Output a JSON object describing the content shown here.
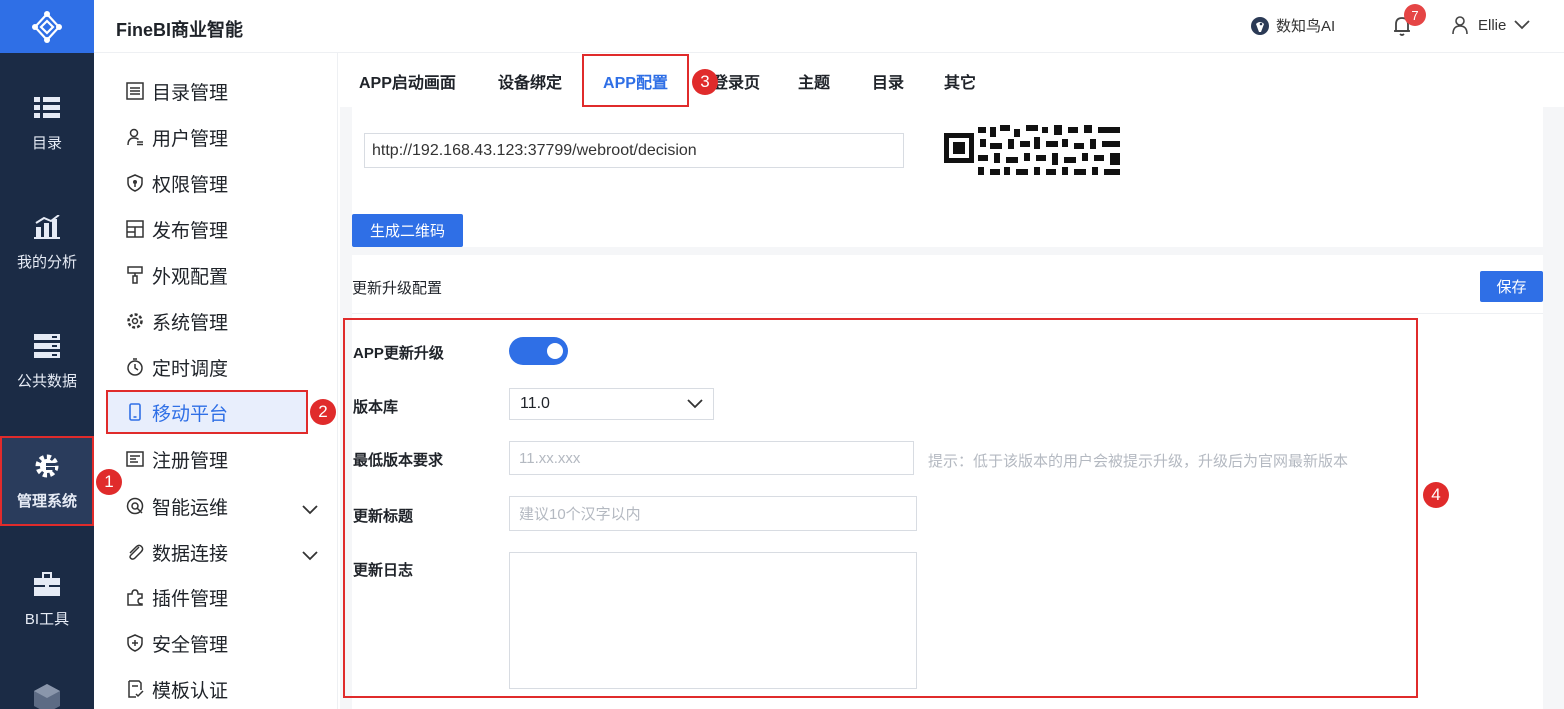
{
  "app": {
    "title": "FineBI商业智能",
    "logo_icon": "finebi-logo-icon"
  },
  "header": {
    "ai_label": "数知鸟AI",
    "notification_count": "7",
    "user_name": "Ellie"
  },
  "rail": {
    "items": [
      {
        "label": "目录",
        "icon": "catalog-icon"
      },
      {
        "label": "我的分析",
        "icon": "analysis-icon"
      },
      {
        "label": "公共数据",
        "icon": "database-icon"
      },
      {
        "label": "管理系统",
        "icon": "settings-icon",
        "active": true
      },
      {
        "label": "BI工具",
        "icon": "toolbox-icon"
      }
    ]
  },
  "menu": {
    "items": [
      {
        "label": "目录管理",
        "icon": "list-icon"
      },
      {
        "label": "用户管理",
        "icon": "user-icon"
      },
      {
        "label": "权限管理",
        "icon": "shield-icon"
      },
      {
        "label": "发布管理",
        "icon": "publish-icon"
      },
      {
        "label": "外观配置",
        "icon": "brush-icon"
      },
      {
        "label": "系统管理",
        "icon": "gear-icon"
      },
      {
        "label": "定时调度",
        "icon": "timer-icon"
      },
      {
        "label": "移动平台",
        "icon": "mobile-icon",
        "active": true
      },
      {
        "label": "注册管理",
        "icon": "register-icon"
      },
      {
        "label": "智能运维",
        "icon": "maintenance-icon",
        "expandable": true
      },
      {
        "label": "数据连接",
        "icon": "link-icon",
        "expandable": true
      },
      {
        "label": "插件管理",
        "icon": "plugin-icon"
      },
      {
        "label": "安全管理",
        "icon": "security-icon"
      },
      {
        "label": "模板认证",
        "icon": "template-icon"
      }
    ]
  },
  "tabs": [
    {
      "label": "APP启动画面"
    },
    {
      "label": "设备绑定"
    },
    {
      "label": "APP配置",
      "active": true
    },
    {
      "label": "登录页"
    },
    {
      "label": "主题"
    },
    {
      "label": "目录"
    },
    {
      "label": "其它"
    }
  ],
  "qr_section": {
    "url": "http://192.168.43.123:37799/webroot/decision",
    "generate_label": "生成二维码"
  },
  "update_section": {
    "title": "更新升级配置",
    "save_label": "保存",
    "app_update": {
      "label": "APP更新升级",
      "enabled": true
    },
    "version_repo": {
      "label": "版本库",
      "value": "11.0"
    },
    "min_version": {
      "label": "最低版本要求",
      "placeholder": "11.xx.xxx",
      "hint": "提示：低于该版本的用户会被提示升级，升级后为官网最新版本"
    },
    "update_title": {
      "label": "更新标题",
      "placeholder": "建议10个汉字以内"
    },
    "update_log": {
      "label": "更新日志",
      "value": ""
    }
  },
  "markers": [
    "1",
    "2",
    "3",
    "4"
  ],
  "colors": {
    "accent": "#2f6fe6",
    "rail_bg": "#1b2b45",
    "highlight": "#e02b2b",
    "badge": "#e54545"
  }
}
